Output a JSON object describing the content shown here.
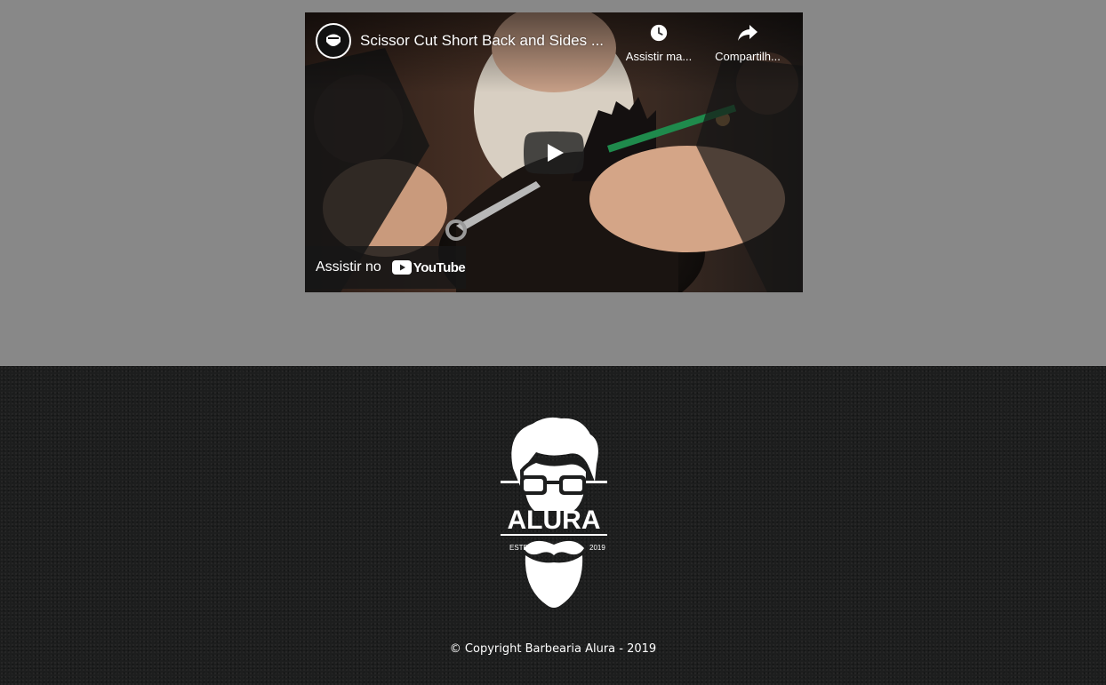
{
  "video": {
    "title": "Scissor Cut Short Back and Sides ...",
    "watch_later_label": "Assistir ma...",
    "share_label": "Compartilh...",
    "watch_on_label": "Assistir no",
    "youtube_brand": "YouTube",
    "icons": {
      "channel_avatar": "beard-logo-icon",
      "watch_later": "clock-icon",
      "share": "share-arrow-icon",
      "play": "play-icon",
      "youtube": "youtube-logo-icon"
    }
  },
  "footer": {
    "logo": {
      "brand": "ALURA",
      "estd_label": "ESTD",
      "year": "2019",
      "icon": "bearded-man-logo"
    },
    "copyright": "© Copyright Barbearia Alura - 2019"
  },
  "colors": {
    "page_background": "#888888",
    "footer_background": "#1d1e1e",
    "youtube_red": "#ff0000",
    "text_white": "#ffffff"
  }
}
